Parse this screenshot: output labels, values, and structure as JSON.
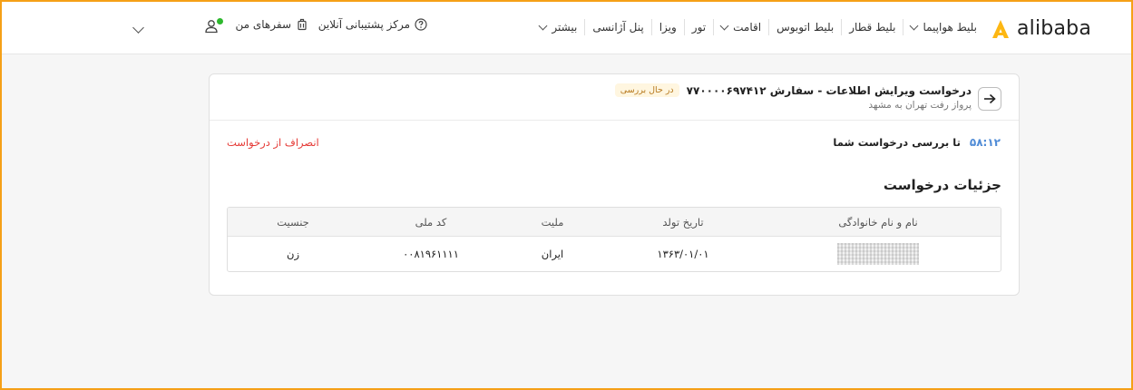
{
  "brand": {
    "name": "alibaba",
    "accent_color": "#fdb713"
  },
  "nav": {
    "items": [
      {
        "label": "بلیط هواپیما",
        "has_dropdown": true
      },
      {
        "label": "بلیط قطار",
        "has_dropdown": false
      },
      {
        "label": "بلیط اتوبوس",
        "has_dropdown": false
      },
      {
        "label": "اقامت",
        "has_dropdown": true
      },
      {
        "label": "تور",
        "has_dropdown": false
      },
      {
        "label": "ویزا",
        "has_dropdown": false
      },
      {
        "label": "پنل آژانسی",
        "has_dropdown": false
      },
      {
        "label": "بیشتر",
        "has_dropdown": true
      }
    ]
  },
  "utility": {
    "support_label": "مرکز پشتیبانی آنلاین",
    "trips_label": "سفرهای من",
    "support_icon": "question-circle-icon",
    "trips_icon": "suitcase-icon",
    "user_icon": "user-icon",
    "status_dot_color": "#2eb82e"
  },
  "request": {
    "title": "درخواست ویرایش اطلاعات - سفارش ۷۷۰۰۰۰۶۹۷۴۱۲",
    "status_badge": "در حال بررسی",
    "subtitle": "پرواز رفت تهران به مشهد",
    "timer": "۵۸:۱۲",
    "timer_label": "تا بررسی درخواست شما",
    "cancel_label": "انصراف از درخواست"
  },
  "details": {
    "section_title": "جزئیات درخواست",
    "columns": [
      "نام و نام خانوادگی",
      "تاریخ تولد",
      "ملیت",
      "کد ملی",
      "جنسیت"
    ],
    "rows": [
      {
        "birth_date": "۱۳۶۳/۰۱/۰۱",
        "nationality": "ایران",
        "national_code": "۰۰۸۱۹۶۱۱۱۱",
        "gender": "زن"
      }
    ]
  }
}
